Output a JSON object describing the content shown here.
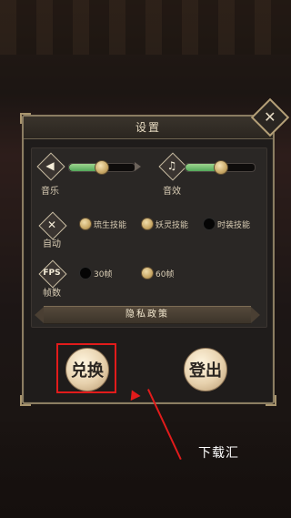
{
  "dialog": {
    "title": "设置",
    "close_icon": "close-x-icon",
    "privacy_label": "隐私政策"
  },
  "audio": {
    "music": {
      "label": "音乐",
      "icon": "speaker-icon",
      "glyph": "◀",
      "level": 0.48
    },
    "sound": {
      "label": "音效",
      "icon": "music-note-icon",
      "glyph": "♫",
      "level": 0.5
    }
  },
  "auto": {
    "label": "自动",
    "icon": "crossed-swords-icon",
    "glyph": "✕",
    "options": [
      {
        "label": "琉生技能",
        "checked": true
      },
      {
        "label": "妖灵技能",
        "checked": true
      },
      {
        "label": "时装技能",
        "checked": false
      }
    ]
  },
  "fps": {
    "label": "帧数",
    "icon": "fps-icon",
    "glyph": "FPS",
    "options": [
      {
        "label": "30帧",
        "checked": false
      },
      {
        "label": "60帧",
        "checked": true
      }
    ]
  },
  "buttons": {
    "redeem_glyph": "兑换",
    "logout_glyph": "登出"
  },
  "watermark": "下载汇",
  "colors": {
    "highlight": "#e21b1b",
    "slider_fill": "#54a85b"
  }
}
